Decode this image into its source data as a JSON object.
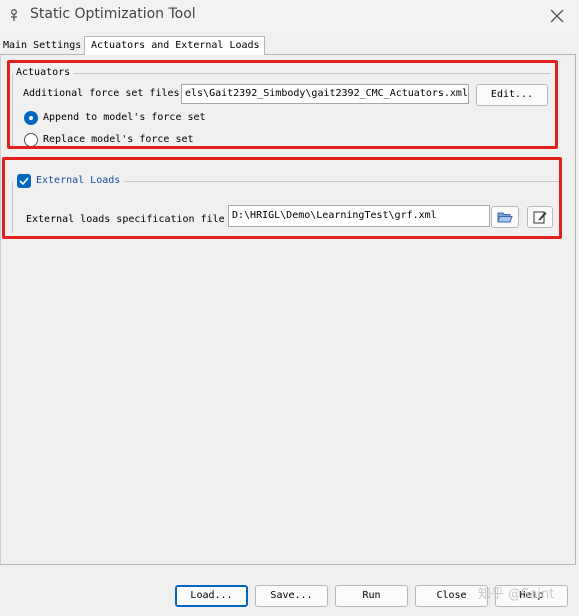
{
  "window": {
    "title": "Static Optimization Tool"
  },
  "tabs": [
    {
      "label": "Main Settings",
      "active": false
    },
    {
      "label": "Actuators and External Loads",
      "active": true
    }
  ],
  "actuators": {
    "group_label": "Actuators",
    "force_set_label": "Additional force set files",
    "force_set_value": "els\\Gait2392_Simbody\\gait2392_CMC_Actuators.xml",
    "edit_label": "Edit...",
    "append_label": "Append to model's force set",
    "replace_label": "Replace model's force set",
    "append_selected": true
  },
  "external_loads": {
    "group_label": "External Loads",
    "checked": true,
    "spec_label": "External loads specification file",
    "spec_value": "D:\\HRIGL\\Demo\\LearningTest\\grf.xml"
  },
  "footer": {
    "load_label": "Load...",
    "save_label": "Save...",
    "run_label": "Run",
    "close_label": "Close",
    "help_label": "Help"
  },
  "watermark": "知乎 @Saint",
  "colors": {
    "accent": "#0067c0",
    "highlight": "#e0211d"
  }
}
